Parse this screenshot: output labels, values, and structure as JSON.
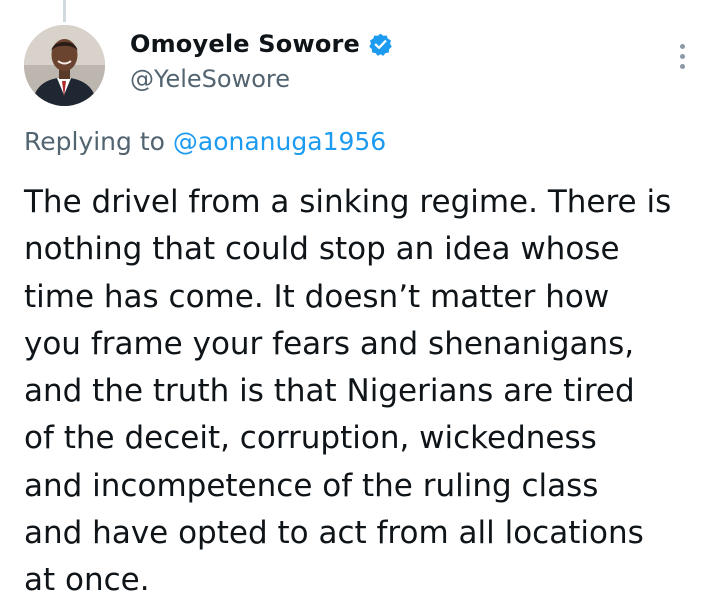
{
  "tweet": {
    "author": {
      "display_name": "Omoyele Sowore",
      "handle": "@YeleSowore",
      "verified": true,
      "avatar_icon": "profile-photo"
    },
    "replying_prefix": "Replying to",
    "replying_to": "@aonanuga1956",
    "text_lines": [
      "The drivel from a sinking regime. There is",
      "nothing that could stop an idea whose",
      "time has come. It doesn’t matter how",
      "you frame your fears and shenanigans,",
      "and the truth is that Nigerians are tired",
      "of the deceit, corruption, wickedness",
      "and incompetence of the ruling class",
      "and have opted to act from all locations",
      "at once."
    ],
    "more_icon": "more-vertical-icon"
  },
  "colors": {
    "link": "#1d9bf0",
    "secondary_text": "#536471",
    "primary_text": "#0f1419",
    "thread_line": "#cfd9de"
  }
}
